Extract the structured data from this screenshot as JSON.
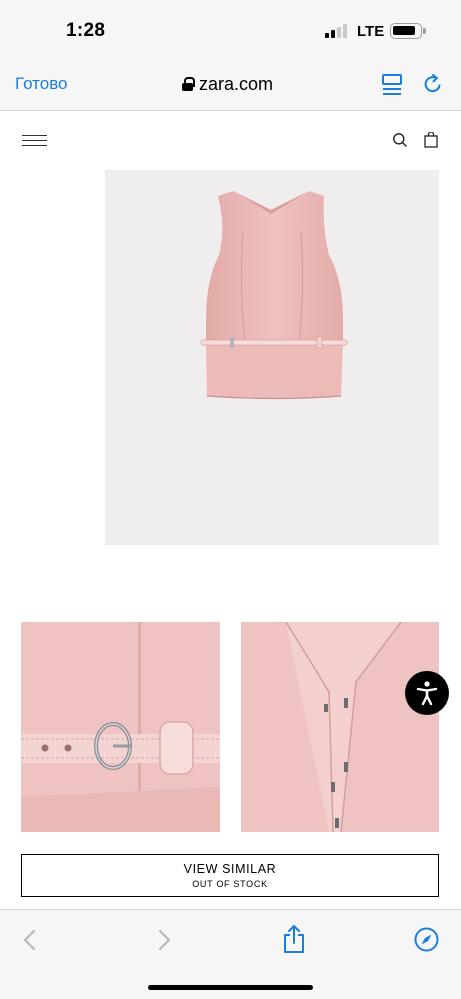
{
  "status_bar": {
    "time": "1:28",
    "network": "LTE",
    "signal_bars": 4,
    "signal_bars_active": 2
  },
  "safari": {
    "done_label": "Готово",
    "url": "zara.com",
    "accent_color": "#1a7ee0"
  },
  "page": {
    "icons": [
      "menu-icon",
      "search-icon",
      "bag-icon",
      "accessibility-icon"
    ],
    "images": [
      "product-vest-front",
      "detail-belt-buckle",
      "detail-hook-closure"
    ],
    "product_color": "#efc3c1",
    "view_similar_label": "VIEW SIMILAR",
    "stock_status": "OUT OF STOCK"
  },
  "toolbar": {
    "icons": [
      "back-icon",
      "forward-icon",
      "share-icon",
      "compass-icon"
    ]
  }
}
